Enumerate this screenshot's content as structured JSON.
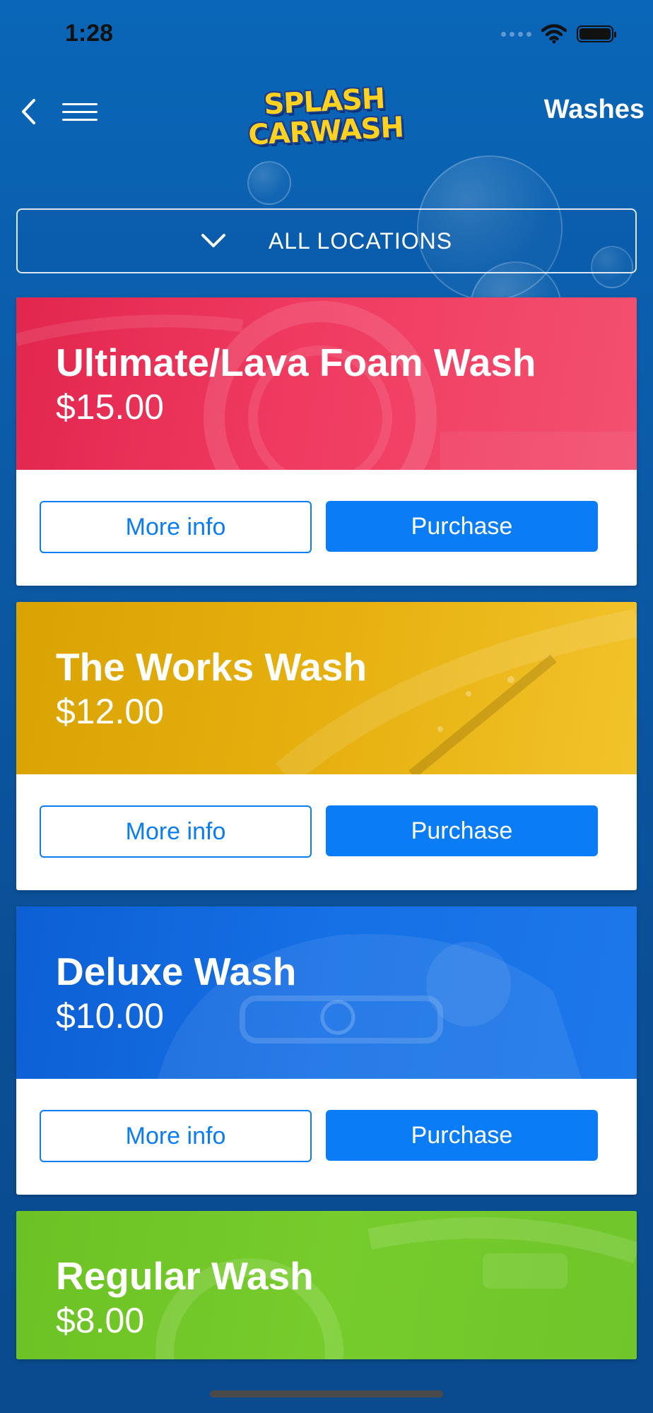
{
  "status_bar": {
    "time": "1:28"
  },
  "header": {
    "logo_line1": "SPLASH",
    "logo_line2": "CARWASH",
    "title": "Washes"
  },
  "location_filter": {
    "label": "ALL LOCATIONS"
  },
  "washes": [
    {
      "title": "Ultimate/Lava Foam Wash",
      "price": "$15.00",
      "more_info_label": "More info",
      "purchase_label": "Purchase",
      "color": "#e2264e"
    },
    {
      "title": "The Works Wash",
      "price": "$12.00",
      "more_info_label": "More info",
      "purchase_label": "Purchase",
      "color": "#d9a304"
    },
    {
      "title": "Deluxe Wash",
      "price": "$10.00",
      "more_info_label": "More info",
      "purchase_label": "Purchase",
      "color": "#1670e6"
    },
    {
      "title": "Regular Wash",
      "price": "$8.00",
      "color": "#6cc224"
    }
  ],
  "colors": {
    "background": "#0a5aa6",
    "accent": "#0a7cf5"
  }
}
